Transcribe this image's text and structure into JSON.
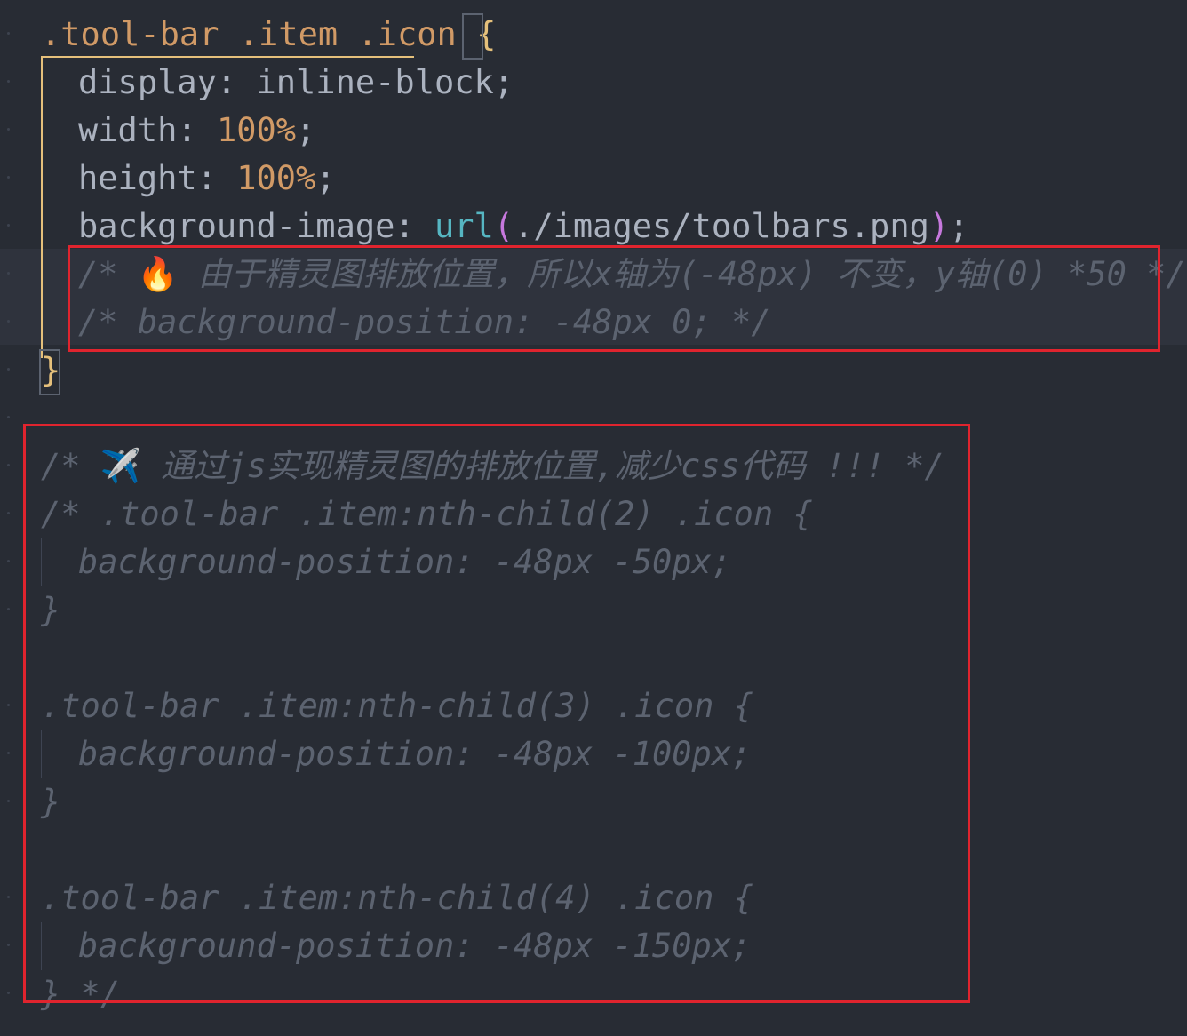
{
  "editor": {
    "theme_colors": {
      "background": "#282c34",
      "selector": "#d19a66",
      "number": "#d19a66",
      "function": "#56b6c2",
      "paren": "#c678dd",
      "brace": "#e5c07b",
      "comment": "#5c6370",
      "annotation_box": "#e0242e"
    },
    "lines": [
      {
        "selector": ".tool-bar .item .icon ",
        "brace": "{"
      },
      {
        "prop": "display: ",
        "value": "inline-block;"
      },
      {
        "prop": "width: ",
        "num": "100%",
        "end": ";"
      },
      {
        "prop": "height: ",
        "num": "100%",
        "end": ";"
      },
      {
        "prop": "background-image: ",
        "fn": "url",
        "paren_open": "(",
        "arg": "./images/toolbars.png",
        "paren_close": ")",
        "end": ";"
      },
      {
        "comment_pre": "/* ",
        "emoji": "🔥",
        "comment": " 由于精灵图排放位置，所以x轴为(-48px) 不变，y轴(0) *50 */"
      },
      {
        "comment": "/* background-position: -48px 0; */"
      },
      {
        "brace": "}"
      },
      {
        "comment_pre": "/* ",
        "emoji": "✈️",
        "comment": " 通过js实现精灵图的排放位置,减少css代码 !!! */"
      },
      {
        "comment": "/* .tool-bar .item:nth-child(2) .icon {"
      },
      {
        "comment": "background-position: -48px -50px;"
      },
      {
        "comment": "}"
      },
      {
        "comment": ".tool-bar .item:nth-child(3) .icon {"
      },
      {
        "comment": "background-position: -48px -100px;"
      },
      {
        "comment": "}"
      },
      {
        "comment": ".tool-bar .item:nth-child(4) .icon {"
      },
      {
        "comment": "background-position: -48px -150px;"
      },
      {
        "comment": "} */"
      }
    ]
  }
}
